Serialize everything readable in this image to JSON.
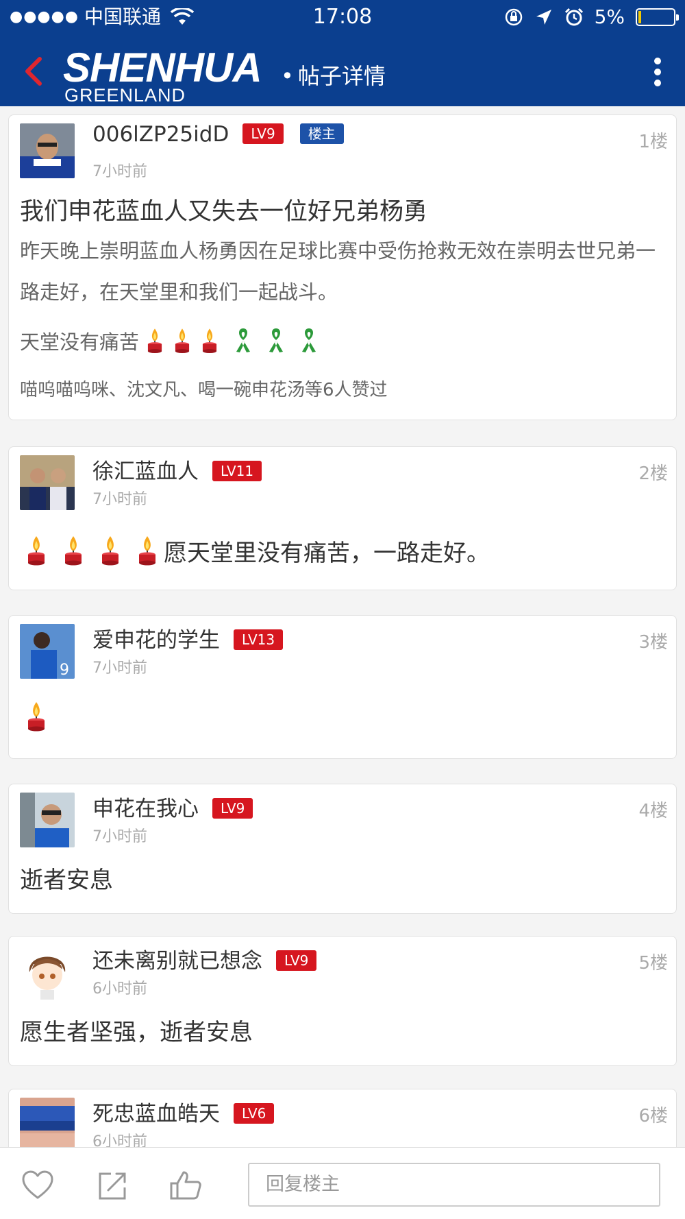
{
  "status_bar": {
    "signal": "●●●●●",
    "carrier": "中国联通",
    "time": "17:08",
    "battery": "5%",
    "battery_level": 0.05
  },
  "nav": {
    "logo_main": "SHENHUA",
    "logo_sub": "GREENLAND",
    "title": "帖子详情",
    "accent_color": "#0b3f8f"
  },
  "posts": [
    {
      "username": "006lZP25idD",
      "level": "LV9",
      "host_badge": "楼主",
      "time": "7小时前",
      "floor": "1楼",
      "title": "我们申花蓝血人又失去一位好兄弟杨勇",
      "body": "昨天晚上崇明蓝血人杨勇因在足球比赛中受伤抢救无效在崇明去世兄弟一路走好，在天堂里和我们一起战斗。",
      "line3": "天堂没有痛苦",
      "likes": "喵呜喵呜咪、沈文凡、喝一碗申花汤等6人赞过"
    },
    {
      "username": "徐汇蓝血人",
      "level": "LV11",
      "time": "7小时前",
      "floor": "2楼",
      "content": "愿天堂里没有痛苦，一路走好。"
    },
    {
      "username": "爱申花的学生",
      "level": "LV13",
      "time": "7小时前",
      "floor": "3楼",
      "content": ""
    },
    {
      "username": "申花在我心",
      "level": "LV9",
      "time": "7小时前",
      "floor": "4楼",
      "content": "逝者安息"
    },
    {
      "username": "还未离别就已想念",
      "level": "LV9",
      "time": "6小时前",
      "floor": "5楼",
      "content": "愿生者坚强，逝者安息"
    },
    {
      "username": "死忠蓝血皓天",
      "level": "LV6",
      "time": "6小时前",
      "floor": "6楼"
    }
  ],
  "bottom_bar": {
    "reply_placeholder": "回复楼主"
  }
}
